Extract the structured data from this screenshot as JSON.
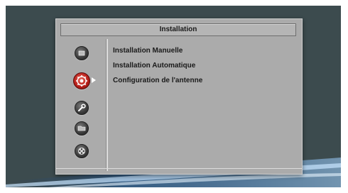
{
  "window": {
    "title": "Installation"
  },
  "menu": {
    "items": [
      {
        "label": "Installation Manuelle"
      },
      {
        "label": "Installation Automatique"
      },
      {
        "label": "Configuration de l'antenne"
      }
    ]
  },
  "sidebar": {
    "icons": [
      "tv-icon",
      "satellite-dish-icon",
      "wrench-icon",
      "folder-icon",
      "film-reel-icon"
    ],
    "selected_index": 1
  },
  "colors": {
    "background": "#3c4b4e",
    "panel": "#ababab",
    "selected_icon": "#c0231c",
    "swoosh": "#4a8fd0"
  }
}
